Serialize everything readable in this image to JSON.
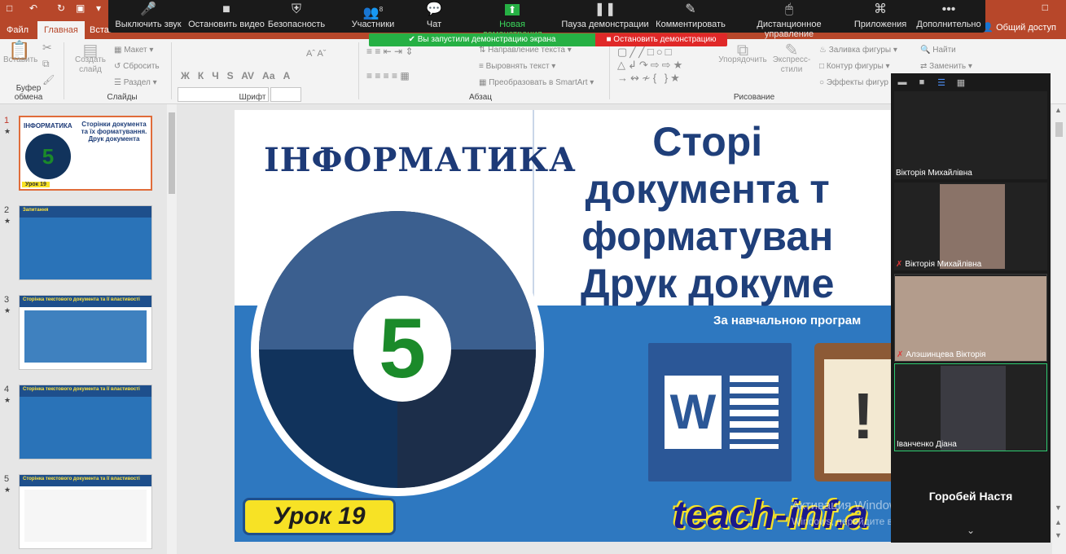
{
  "window": {
    "qa_icons": [
      "save-icon",
      "undo-icon",
      "redo-icon",
      "present-icon",
      "customize-icon"
    ],
    "share_label": "Общий доступ"
  },
  "ribbon_tabs": [
    "Файл",
    "Главная",
    "Вставка"
  ],
  "ribbon": {
    "groups": {
      "clipboard": "Буфер обмена",
      "slides": "Слайды",
      "font": "Шрифт",
      "paragraph": "Абзац",
      "drawing": "Рисование"
    },
    "paste": "Вставить",
    "create_slide": "Создать слайд",
    "layout": "Макет",
    "reset": "Сбросить",
    "section": "Раздел",
    "text_dir": "Направление текста",
    "align_text": "Выровнять текст",
    "smartart": "Преобразовать в SmartArt",
    "arrange": "Упорядочить",
    "express_styles": "Экспресс-стили",
    "shape_fill": "Заливка фигуры",
    "shape_outline": "Контур фигуры",
    "shape_effects": "Эффекты фигур",
    "find": "Найти",
    "replace": "Заменить",
    "font_buttons": [
      "Ж",
      "К",
      "Ч",
      "S",
      "AV",
      "Аа",
      "А"
    ]
  },
  "zoom_toolbar": {
    "items": [
      {
        "id": "mute",
        "label": "Выключить звук",
        "icon": "🎤"
      },
      {
        "id": "stop-video",
        "label": "Остановить видео",
        "icon": "■"
      },
      {
        "id": "security",
        "label": "Безопасность",
        "icon": "⛨"
      },
      {
        "id": "participants",
        "label": "Участники",
        "icon": "👥",
        "count": "8"
      },
      {
        "id": "chat",
        "label": "Чат",
        "icon": "💬"
      },
      {
        "id": "new-share",
        "label": "Новая демонстрация",
        "icon": "⬆"
      },
      {
        "id": "pause-share",
        "label": "Пауза демонстрации",
        "icon": "❚❚"
      },
      {
        "id": "annotate",
        "label": "Комментировать",
        "icon": "✎"
      },
      {
        "id": "remote-control",
        "label": "Дистанционное управление",
        "icon": "🖱"
      },
      {
        "id": "apps",
        "label": "Приложения",
        "icon": "⌘"
      },
      {
        "id": "more",
        "label": "Дополнительно",
        "icon": "•••"
      }
    ],
    "sharing_banner": "Вы запустили демонстрацию экрана",
    "stop_share": "Остановить демонстрацию"
  },
  "thumbnails": [
    {
      "num": "1",
      "title": "Сторінки документа та їх форматування. Друк документа",
      "lesson": "Урок 19"
    },
    {
      "num": "2",
      "title": "Запитання"
    },
    {
      "num": "3",
      "title": "Сторінка текстового документа та її властивості"
    },
    {
      "num": "4",
      "title": "Сторінка текстового документа та її властивості"
    },
    {
      "num": "5",
      "title": "Сторінка текстового документа та її властивості"
    }
  ],
  "slide": {
    "brand": "ІНФОРМАТИКА",
    "grade": "5",
    "title_lines": [
      "Сторі",
      "документа т",
      "форматуван",
      "Друк докуме"
    ],
    "subtitle": "За навчальною програм",
    "lesson": "Урок 19",
    "site": "teach-inf.a"
  },
  "watermark": {
    "line1": "Активация Windows",
    "line2": "Windows, перейдите в раздел"
  },
  "participants": {
    "view_buttons": [
      "minimize-icon",
      "strip-icon",
      "speaker-view-icon",
      "gallery-view-icon"
    ],
    "tiles": [
      {
        "name": "Вікторія Михайлівна",
        "muted": false,
        "video": false
      },
      {
        "name": "Вікторія Михайлівна",
        "muted": true,
        "video": true,
        "bg": "#8a7368"
      },
      {
        "name": "Алэшинцева Вікторія",
        "muted": true,
        "video": true,
        "bg": "#b39c8c"
      },
      {
        "name": "Іванченко Діана",
        "muted": false,
        "video": true,
        "bg": "#3b3b42"
      }
    ],
    "active_name": "Горобей Настя"
  },
  "colors": {
    "ppt_accent": "#b7472a",
    "zoom_green": "#26b044",
    "zoom_red": "#e02828"
  }
}
